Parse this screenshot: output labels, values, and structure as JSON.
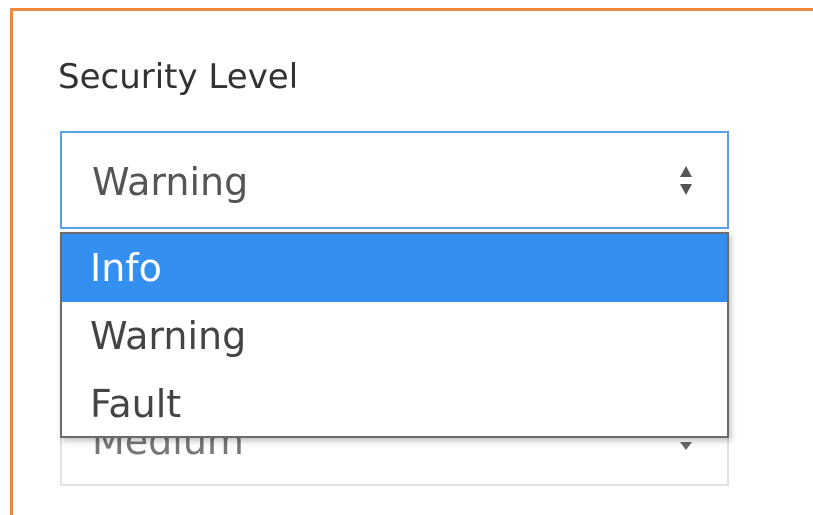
{
  "form": {
    "security_level_label": "Security Level",
    "security_level_value": "Warning",
    "security_level_options": [
      "Info",
      "Warning",
      "Fault"
    ],
    "highlighted_option": "Info",
    "next_select_value": "Medium"
  },
  "colors": {
    "panel_border": "#f0883e",
    "select_focus_border": "#5aa0e6",
    "option_highlight": "#3390f0"
  },
  "icons": {
    "select_arrows": "up-down-arrows-icon",
    "next_select_arrow": "chevron-down-icon"
  }
}
